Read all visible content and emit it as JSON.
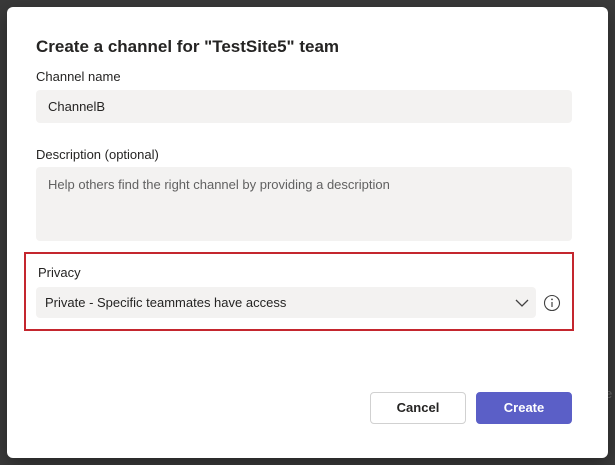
{
  "dialog": {
    "title": "Create a channel for \"TestSite5\" team",
    "channel_name": {
      "label": "Channel name",
      "value": "ChannelB"
    },
    "description": {
      "label": "Description (optional)",
      "placeholder": "Help others find the right channel by providing a description"
    },
    "privacy": {
      "label": "Privacy",
      "selected": "Private - Specific teammates have access",
      "highlight_color": "#c4262e"
    },
    "buttons": {
      "cancel": "Cancel",
      "create": "Create"
    }
  },
  "colors": {
    "accent": "#5b5fc7",
    "input_bg": "#f3f2f1"
  },
  "icons": [
    "chevron-down-icon",
    "info-icon"
  ]
}
